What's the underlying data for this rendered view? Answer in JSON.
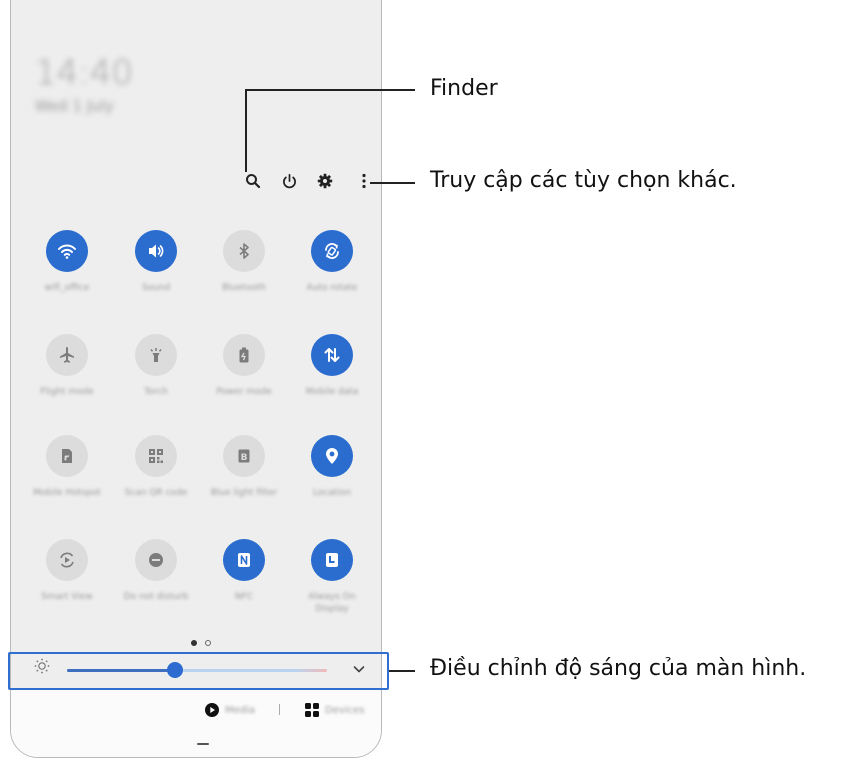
{
  "status": {
    "clock": "14:40",
    "date": "Wed 1 July"
  },
  "toolbar": {
    "icons": [
      "search-icon",
      "power-icon",
      "gear-icon",
      "more-vertical-icon"
    ]
  },
  "tiles": [
    {
      "label": "wifi_office",
      "icon": "wifi-icon",
      "active": true
    },
    {
      "label": "Sound",
      "icon": "speaker-icon",
      "active": true
    },
    {
      "label": "Bluetooth",
      "icon": "bluetooth-icon",
      "active": false
    },
    {
      "label": "Auto rotate",
      "icon": "rotate-icon",
      "active": true
    },
    {
      "label": "Flight mode",
      "icon": "airplane-icon",
      "active": false
    },
    {
      "label": "Torch",
      "icon": "torch-icon",
      "active": false
    },
    {
      "label": "Power mode",
      "icon": "battery-icon",
      "active": false
    },
    {
      "label": "Mobile data",
      "icon": "data-arrows-icon",
      "active": true
    },
    {
      "label": "Mobile Hotspot",
      "icon": "hotspot-icon",
      "active": false
    },
    {
      "label": "Scan QR code",
      "icon": "qr-icon",
      "active": false
    },
    {
      "label": "Blue light filter",
      "icon": "blue-light-icon",
      "active": false
    },
    {
      "label": "Location",
      "icon": "location-pin-icon",
      "active": true
    },
    {
      "label": "Smart View",
      "icon": "smart-view-icon",
      "active": false
    },
    {
      "label": "Do not disturb",
      "icon": "dnd-icon",
      "active": false
    },
    {
      "label": "NFC",
      "icon": "nfc-icon",
      "active": true
    },
    {
      "label": "Always On Display",
      "icon": "aod-icon",
      "active": true
    }
  ],
  "pagination": {
    "pages": 2,
    "current": 1
  },
  "brightness": {
    "level": 0.4
  },
  "bottom": {
    "media_label": "Media",
    "devices_label": "Devices"
  },
  "callouts": {
    "finder": "Finder",
    "more_options": "Truy cập các tùy chọn khác.",
    "brightness": "Điều chỉnh độ sáng của màn hình."
  },
  "colors": {
    "accent": "#2b6ccf",
    "tile_off": "#dcdcdc",
    "panel": "#eeeeee"
  }
}
